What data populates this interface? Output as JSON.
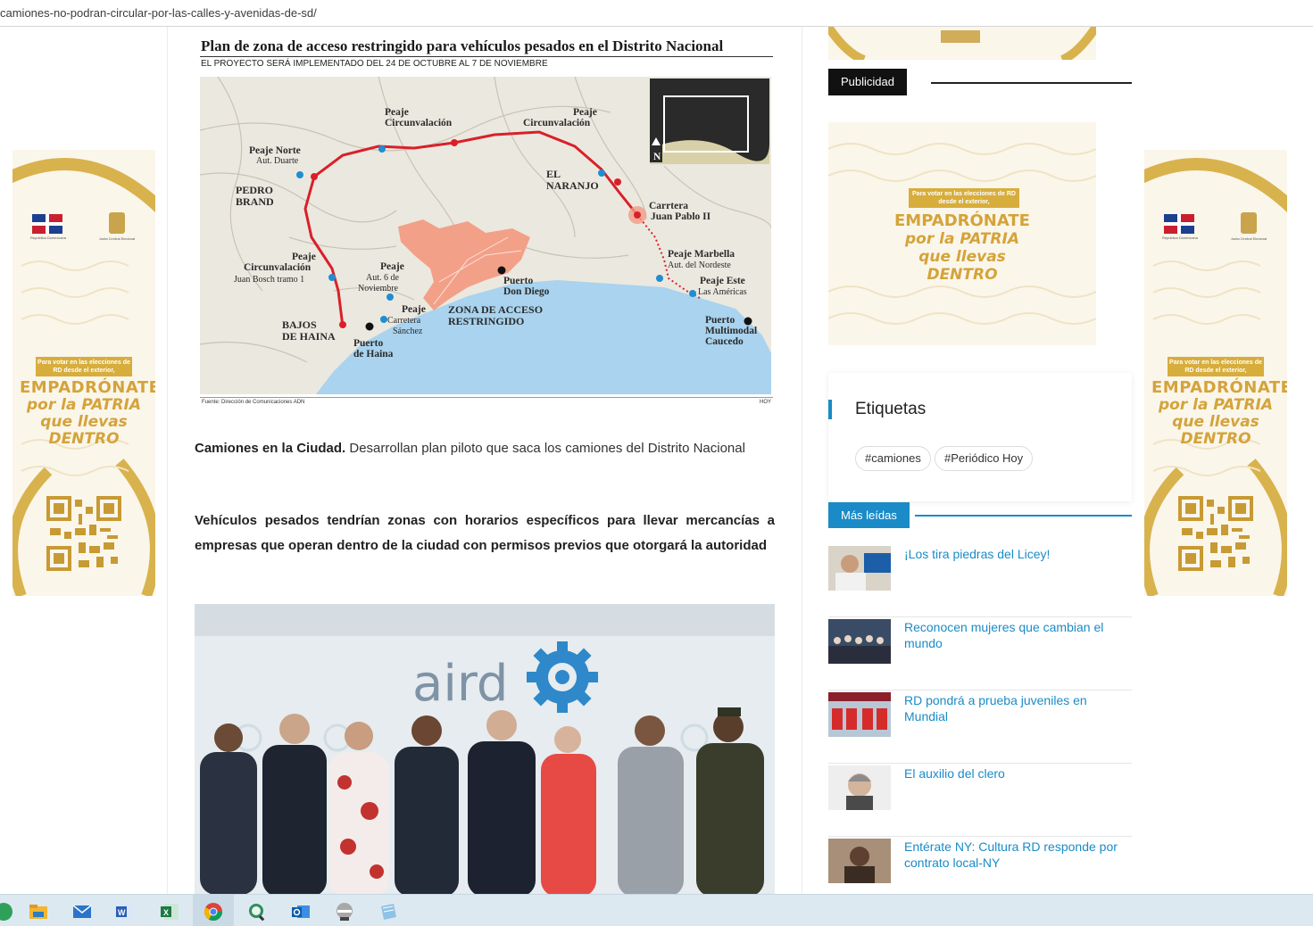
{
  "browser": {
    "url": "camiones-no-podran-circular-por-las-calles-y-avenidas-de-sd/"
  },
  "article": {
    "map": {
      "title": "Plan de zona de acceso restringido para vehículos pesados en el Distrito Nacional",
      "subtitle": "EL PROYECTO SERÁ IMPLEMENTADO DEL 24 DE OCTUBRE AL 7 DE NOVIEMBRE",
      "source": "Fuente: Dirección de Comunicaciones ADN",
      "brand": "HOY",
      "labels": {
        "peaje_norte": "Peaje Norte",
        "aut_duarte": "Aut. Duarte",
        "pedro_brand_1": "PEDRO",
        "pedro_brand_2": "BRAND",
        "peaje_circ1_a": "Peaje",
        "peaje_circ1_b": "Circunvalación",
        "peaje_circ2_a": "Peaje",
        "peaje_circ2_b": "Circunvalación",
        "el_naranjo_1": "EL",
        "el_naranjo_2": "NARANJO",
        "carretera_jp_1": "Carrtera",
        "carretera_jp_2": "Juan Pablo II",
        "peaje_marbella": "Peaje Marbella",
        "aut_nordeste": "Aut. del Nordeste",
        "peaje_este": "Peaje Este",
        "las_americas": "Las Américas",
        "puerto_multimodal_1": "Puerto",
        "puerto_multimodal_2": "Multimodal",
        "puerto_multimodal_3": "Caucedo",
        "peaje_circ3_a": "Peaje",
        "peaje_circ3_b": "Circunvalación",
        "juan_bosch": "Juan Bosch tramo 1",
        "peaje_aut6_a": "Peaje",
        "peaje_aut6_b": "Aut. 6 de",
        "peaje_aut6_c": "Noviembre",
        "puerto_dd_1": "Puerto",
        "puerto_dd_2": "Don Diego",
        "peaje_sanchez_a": "Peaje",
        "peaje_sanchez_b": "Carretera",
        "peaje_sanchez_c": "Sánchez",
        "zona_1": "ZONA DE ACCESO",
        "zona_2": "RESTRINGIDO",
        "bajos_haina_1": "BAJOS",
        "bajos_haina_2": "DE HAINA",
        "puerto_haina_1": "Puerto",
        "puerto_haina_2": "de Haina",
        "north": "N"
      }
    },
    "p1_bold": "Camiones en la Ciudad.",
    "p1_rest": " Desarrollan plan piloto que saca los camiones del Distrito Nacional",
    "p2": "Vehículos pesados tendrían zonas con horarios específicos para llevar mercancías a empresas que operan dentro de la ciudad con permisos previos que otorgará la autoridad",
    "photo_logo": "aird"
  },
  "ads": {
    "small_box": "Para votar en las elecciones de RD desde el exterior,",
    "main_l1": "EMPADRÓNATE",
    "main_l2": "por la PATRIA",
    "main_l3": "que llevas DENTRO",
    "flag_label": "República Dominicana",
    "jce_label": "Junta Central Electoral"
  },
  "sidebar": {
    "publicidad": "Publicidad",
    "etiquetas": "Etiquetas",
    "tags": [
      "#camiones",
      "#Periódico Hoy"
    ],
    "mas_leidas": "Más leídas",
    "items": [
      {
        "title": "¡Los tira piedras del Licey!"
      },
      {
        "title": "Reconocen mujeres que cambian el mundo"
      },
      {
        "title": "RD pondrá a prueba juveniles en Mundial"
      },
      {
        "title": "El auxilio del clero"
      },
      {
        "title": "Entérate NY: Cultura RD responde por contrato local-NY"
      }
    ]
  },
  "taskbar": {
    "apps": [
      "edge-icon",
      "file-explorer-icon",
      "mail-icon",
      "word-icon",
      "excel-icon",
      "chrome-icon",
      "search-app-icon",
      "outlook-icon",
      "pro-app-icon",
      "notes-icon"
    ]
  },
  "colors": {
    "accent": "#1a8bc7",
    "route": "#d9202a",
    "zone": "#f3a088",
    "water": "#a9d3ee",
    "gold": "#d4a33a"
  }
}
